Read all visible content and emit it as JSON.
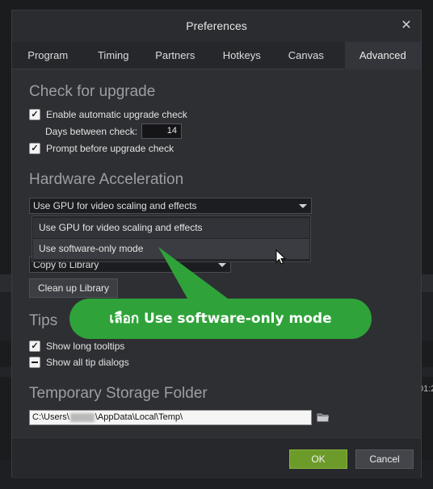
{
  "window": {
    "title": "Preferences"
  },
  "tabs": [
    {
      "label": "Program",
      "active": false
    },
    {
      "label": "Timing",
      "active": false
    },
    {
      "label": "Partners",
      "active": false
    },
    {
      "label": "Hotkeys",
      "active": false
    },
    {
      "label": "Canvas",
      "active": false
    },
    {
      "label": "Advanced",
      "active": true
    }
  ],
  "upgrade": {
    "title": "Check for upgrade",
    "auto_check_label": "Enable automatic upgrade check",
    "auto_check_checked": true,
    "days_label": "Days between check:",
    "days_value": "14",
    "prompt_label": "Prompt before upgrade check",
    "prompt_checked": true
  },
  "hardware": {
    "title": "Hardware Acceleration",
    "selected": "Use GPU for video scaling and effects",
    "options": [
      "Use GPU for video scaling and effects",
      "Use software-only mode"
    ]
  },
  "library": {
    "select_value": "Copy to Library",
    "cleanup_label": "Clean up Library"
  },
  "tips": {
    "title": "Tips",
    "long_tooltips_label": "Show long tooltips",
    "long_tooltips_checked": true,
    "all_dialogs_label": "Show all tip dialogs",
    "all_dialogs_state": "indeterminate"
  },
  "temp": {
    "title": "Temporary Storage Folder",
    "path_prefix": "C:\\Users\\",
    "path_suffix": "\\AppData\\Local\\Temp\\"
  },
  "footer": {
    "ok_label": "OK",
    "cancel_label": "Cancel"
  },
  "annotation": {
    "text": "เลือก Use software-only mode",
    "color": "#2fa33a"
  },
  "background": {
    "partial_text": "01:2"
  },
  "colors": {
    "ok_green": "#6d9b2a",
    "callout_green": "#2fa33a",
    "bg": "#2e2f33"
  }
}
